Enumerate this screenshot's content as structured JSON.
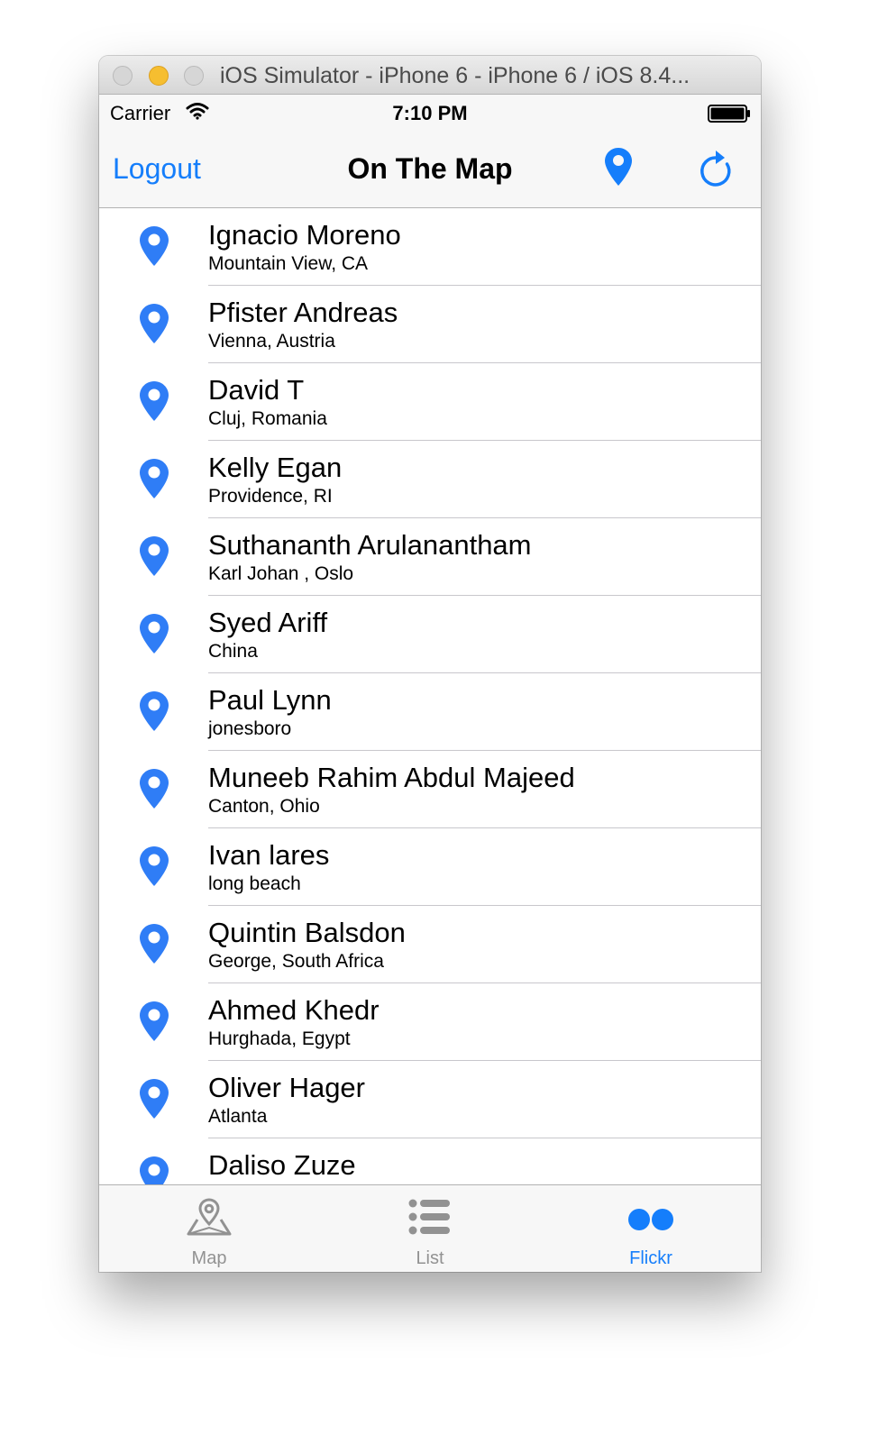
{
  "window": {
    "title": "iOS Simulator - iPhone 6 - iPhone 6 / iOS 8.4..."
  },
  "status_bar": {
    "carrier": "Carrier",
    "time": "7:10 PM"
  },
  "nav_bar": {
    "left_button": "Logout",
    "title": "On The Map",
    "right_icons": [
      "map-pin-icon",
      "refresh-icon"
    ]
  },
  "students": [
    {
      "name": "Ignacio Moreno",
      "location": "Mountain View, CA"
    },
    {
      "name": "Pfister Andreas",
      "location": "Vienna, Austria"
    },
    {
      "name": "David T",
      "location": "Cluj, Romania"
    },
    {
      "name": "Kelly Egan",
      "location": "Providence, RI"
    },
    {
      "name": "Suthananth Arulanantham",
      "location": "Karl Johan , Oslo"
    },
    {
      "name": "Syed Ariff",
      "location": "China"
    },
    {
      "name": "Paul Lynn",
      "location": "jonesboro"
    },
    {
      "name": "Muneeb Rahim Abdul Majeed",
      "location": "Canton, Ohio"
    },
    {
      "name": "Ivan lares",
      "location": "long beach"
    },
    {
      "name": "Quintin Balsdon",
      "location": "George, South Africa"
    },
    {
      "name": "Ahmed Khedr",
      "location": "Hurghada, Egypt"
    },
    {
      "name": "Oliver Hager",
      "location": "Atlanta"
    },
    {
      "name": "Daliso Zuze",
      "location": ""
    }
  ],
  "tab_bar": {
    "tabs": [
      {
        "label": "Map",
        "icon": "map-icon",
        "selected": false
      },
      {
        "label": "List",
        "icon": "list-icon",
        "selected": false
      },
      {
        "label": "Flickr",
        "icon": "flickr-icon",
        "selected": true
      }
    ]
  },
  "colors": {
    "accent": "#157efb",
    "pin": "#2f7df6",
    "inactive_tab": "#929292"
  }
}
